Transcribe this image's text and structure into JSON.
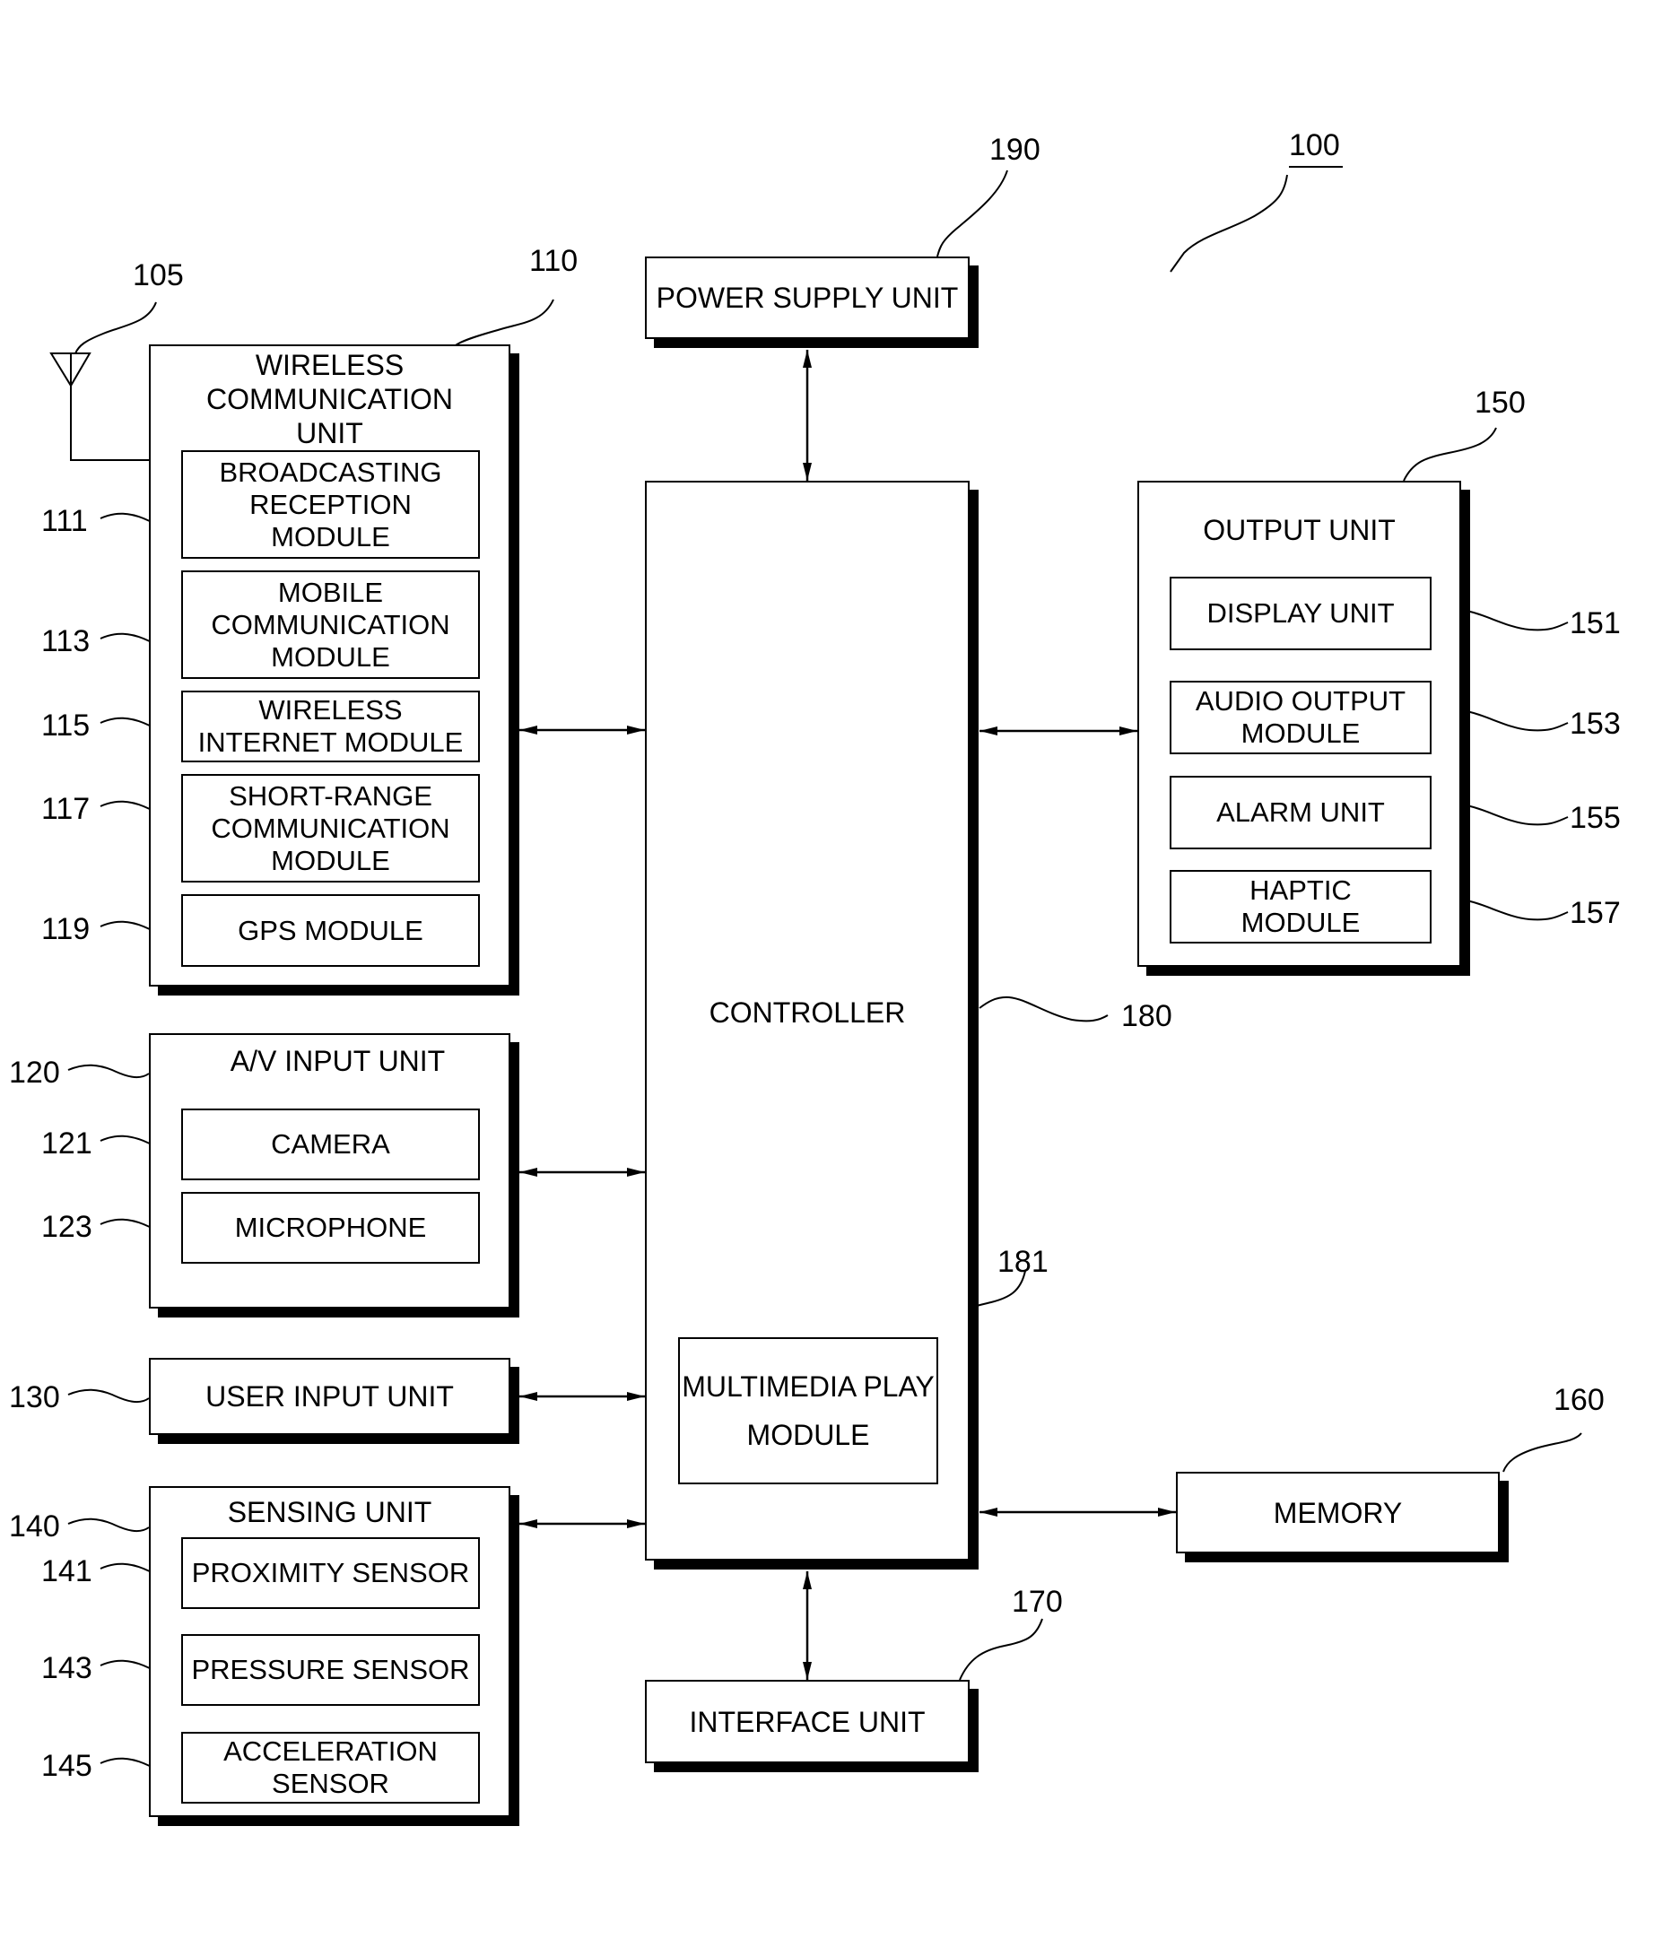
{
  "figure_label": "100",
  "power_supply": {
    "ref": "190",
    "label": "POWER SUPPLY UNIT"
  },
  "controller": {
    "ref": "180",
    "label": "CONTROLLER",
    "multimedia": {
      "ref": "181",
      "label": "MULTIMEDIA PLAY\nMODULE"
    }
  },
  "interface": {
    "ref": "170",
    "label": "INTERFACE UNIT"
  },
  "memory": {
    "ref": "160",
    "label": "MEMORY"
  },
  "antenna": {
    "ref": "105"
  },
  "wireless": {
    "ref": "110",
    "label": "WIRELESS\nCOMMUNICATION\nUNIT",
    "modules": [
      {
        "ref": "111",
        "label": "BROADCASTING\nRECEPTION\nMODULE"
      },
      {
        "ref": "113",
        "label": "MOBILE\nCOMMUNICATION\nMODULE"
      },
      {
        "ref": "115",
        "label": "WIRELESS\nINTERNET MODULE"
      },
      {
        "ref": "117",
        "label": "SHORT-RANGE\nCOMMUNICATION\nMODULE"
      },
      {
        "ref": "119",
        "label": "GPS MODULE"
      }
    ]
  },
  "av_input": {
    "ref": "120",
    "label": "A/V INPUT UNIT",
    "modules": [
      {
        "ref": "121",
        "label": "CAMERA"
      },
      {
        "ref": "123",
        "label": "MICROPHONE"
      }
    ]
  },
  "user_input": {
    "ref": "130",
    "label": "USER INPUT UNIT"
  },
  "sensing": {
    "ref": "140",
    "label": "SENSING UNIT",
    "modules": [
      {
        "ref": "141",
        "label": "PROXIMITY SENSOR"
      },
      {
        "ref": "143",
        "label": "PRESSURE SENSOR"
      },
      {
        "ref": "145",
        "label": "ACCELERATION\nSENSOR"
      }
    ]
  },
  "output": {
    "ref": "150",
    "label": "OUTPUT UNIT",
    "modules": [
      {
        "ref": "151",
        "label": "DISPLAY UNIT"
      },
      {
        "ref": "153",
        "label": "AUDIO OUTPUT\nMODULE"
      },
      {
        "ref": "155",
        "label": "ALARM UNIT"
      },
      {
        "ref": "157",
        "label": "HAPTIC\nMODULE"
      }
    ]
  }
}
